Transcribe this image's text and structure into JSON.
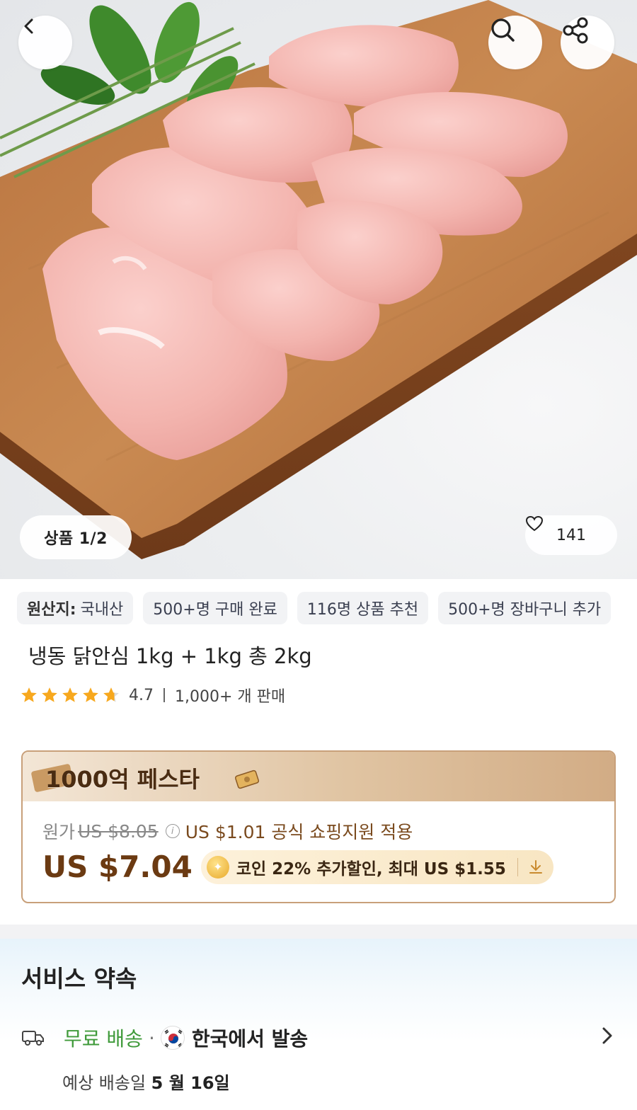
{
  "hero": {
    "image_alt": "",
    "counter": "상품 1/2",
    "likes": "141"
  },
  "icons": {
    "back": "chevron-left-icon",
    "search": "search-icon",
    "share": "share-icon",
    "heart": "heart-icon",
    "truck": "truck-icon",
    "chevron": "chevron-right-icon"
  },
  "tags": [
    {
      "label": "원산지:",
      "value": "국내산"
    },
    {
      "label": "",
      "value": "500+명 구매 완료"
    },
    {
      "label": "",
      "value": "116명 상품 추천"
    },
    {
      "label": "",
      "value": "500+명 장바구니 추가"
    }
  ],
  "product": {
    "title": "냉동 닭안심 1kg + 1kg 총 2kg",
    "rating": 4.7,
    "rating_text": "4.7",
    "sold": "1,000+ 개 판매"
  },
  "promo": {
    "event_title": "1000억 페스타",
    "original_label": "원가",
    "original_price": "US $8.05",
    "support_text": "US $1.01 공식 쇼핑지원 적용",
    "price": "US $7.04",
    "coin_text": "코인 22% 추가할인, 최대 US $1.55"
  },
  "service": {
    "title": "서비스 약속",
    "free_shipping": "무료 배송",
    "separator": "·",
    "ship_from": "한국에서 발송",
    "eta_label": "예상 배송일",
    "eta_date": "5 월 16일"
  },
  "colors": {
    "price_brown": "#6b3a12",
    "free_green": "#3f9a3a",
    "card_border": "#c8a07a"
  }
}
